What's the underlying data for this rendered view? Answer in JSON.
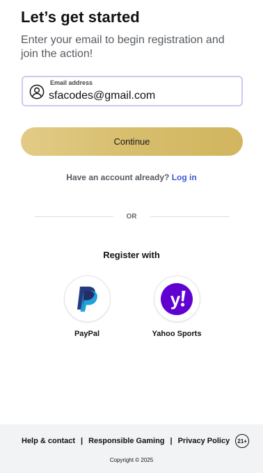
{
  "header": {
    "title": "Let’s get started",
    "subtitle": "Enter your email to begin registration and join the action!"
  },
  "email": {
    "label": "Email address",
    "value": "sfacodes@gmail.com",
    "icon": "user-circle-icon"
  },
  "continue_label": "Continue",
  "account": {
    "prompt": "Have an account already?",
    "login_label": "Log in"
  },
  "or_label": "OR",
  "register": {
    "title": "Register with",
    "providers": [
      {
        "label": "PayPal",
        "icon": "paypal-icon"
      },
      {
        "label": "Yahoo Sports",
        "icon": "yahoo-icon"
      }
    ]
  },
  "footer": {
    "links": [
      "Help & contact",
      "Responsible Gaming",
      "Privacy Policy"
    ],
    "separator": "|",
    "age_badge": "21+",
    "copyright": "Copyright © 2025"
  },
  "colors": {
    "accent_gold": "#d7be6d",
    "link_blue": "#3d57d6",
    "input_border": "#c9cbee",
    "yahoo_purple": "#6001d2",
    "paypal_dark": "#253b80",
    "paypal_light": "#179bd7"
  }
}
